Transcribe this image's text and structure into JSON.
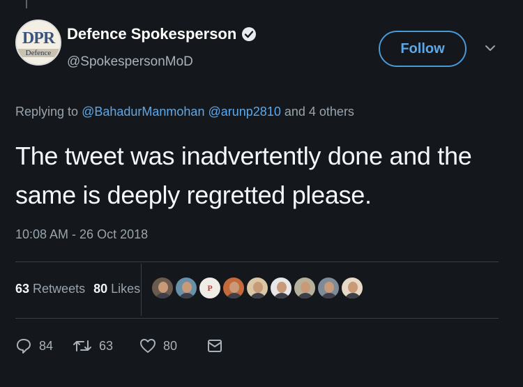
{
  "author": {
    "name": "Defence Spokesperson",
    "handle": "@SpokespersonMoD",
    "avatar_text_main": "DPR",
    "avatar_text_sub": "Defence"
  },
  "follow_button": {
    "label": "Follow"
  },
  "reply": {
    "prefix": "Replying to",
    "mentions": [
      "@BahadurManmohan",
      "@arunp2810"
    ],
    "suffix": "and 4 others"
  },
  "tweet": {
    "text": "The tweet was inadvertently done and the same is deeply regretted please.",
    "timestamp": "10:08 AM - 26 Oct 2018"
  },
  "stats": {
    "retweets_count": "63",
    "retweets_label": "Retweets",
    "likes_count": "80",
    "likes_label": "Likes"
  },
  "likers": [
    {
      "bg": "#6b5a4e",
      "kind": "face"
    },
    {
      "bg": "#6a8fa8",
      "kind": "face"
    },
    {
      "bg": "#f0ede6",
      "kind": "letter",
      "letter": "P"
    },
    {
      "bg": "#c46a3a",
      "kind": "face"
    },
    {
      "bg": "#d9c7a6",
      "kind": "face"
    },
    {
      "bg": "#e8e8e8",
      "kind": "face"
    },
    {
      "bg": "#b7b09a",
      "kind": "face"
    },
    {
      "bg": "#7e8c99",
      "kind": "face"
    },
    {
      "bg": "#e7d9c6",
      "kind": "face"
    }
  ],
  "actions": {
    "replies": "84",
    "retweets": "63",
    "likes": "80"
  },
  "colors": {
    "background": "#14171c",
    "accent": "#5fa8e8",
    "muted": "#9aa4ad"
  }
}
